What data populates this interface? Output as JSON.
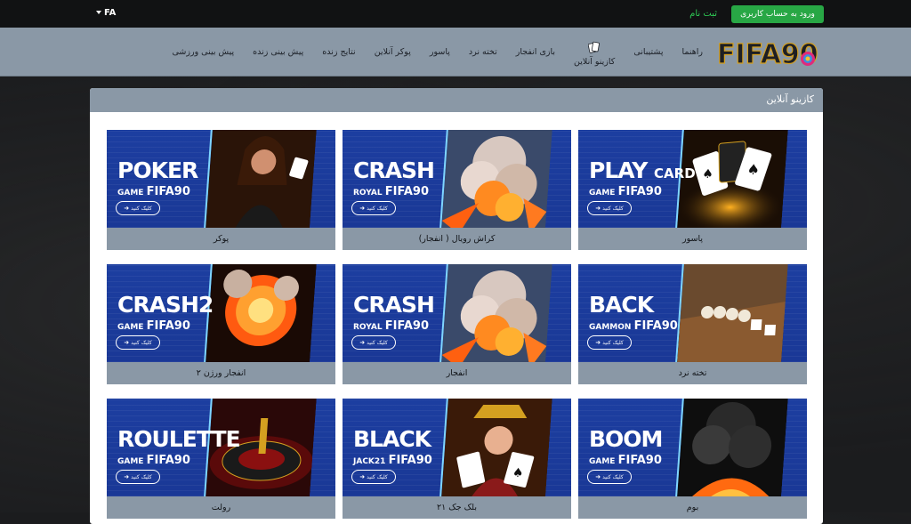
{
  "topbar": {
    "lang": "FA",
    "register": "ثبت نام",
    "login": "ورود به حساب کاربری"
  },
  "nav": {
    "items": [
      "پیش بینی ورزشی",
      "پیش بینی زنده",
      "نتایج زنده",
      "پوکر آنلاین",
      "پاسور",
      "تخته نرد",
      "بازی انفجار",
      "کازینو آنلاین",
      "پشتیبانی",
      "راهنما"
    ]
  },
  "logo": {
    "text": "FIFA90"
  },
  "panel": {
    "title": "کازینو آنلاین"
  },
  "click_label": "کلیک کنید",
  "cards": [
    {
      "t1": "PLAY",
      "t1b": "CARD",
      "t2": "GAME",
      "brand": "FIFA90",
      "caption": "پاسور",
      "art": "cards"
    },
    {
      "t1": "CRASH",
      "t1b": "",
      "t2": "ROYAL",
      "brand": "FIFA90",
      "caption": "کراش رویال ( انفجار)",
      "art": "explosion"
    },
    {
      "t1": "POKER",
      "t1b": "",
      "t2": "GAME",
      "brand": "FIFA90",
      "caption": "پوکر",
      "art": "woman"
    },
    {
      "t1": "BACK",
      "t1b": "",
      "t2": "GAMMON",
      "brand": "FIFA90",
      "caption": "تخته نرد",
      "art": "backgammon"
    },
    {
      "t1": "CRASH",
      "t1b": "",
      "t2": "ROYAL",
      "brand": "FIFA90",
      "caption": "انفجار",
      "art": "explosion"
    },
    {
      "t1": "CRASH2",
      "t1b": "",
      "t2": "GAME",
      "brand": "FIFA90",
      "caption": "انفجار ورژن ۲",
      "art": "fire"
    },
    {
      "t1": "BOOM",
      "t1b": "",
      "t2": "GAME",
      "brand": "FIFA90",
      "caption": "بوم",
      "art": "smoke"
    },
    {
      "t1": "BLACK",
      "t1b": "",
      "t2": "JACK21",
      "brand": "FIFA90",
      "caption": "بلک جک ۲۱",
      "art": "queen"
    },
    {
      "t1": "ROULETTE",
      "t1b": "",
      "t2": "GAME",
      "brand": "FIFA90",
      "caption": "رولت",
      "art": "roulette"
    }
  ],
  "colors": {
    "nav_bg": "#8a98a6",
    "banner_blue": "#1c3ea0",
    "login_green": "#28a745",
    "register_green": "#2ecc55"
  }
}
